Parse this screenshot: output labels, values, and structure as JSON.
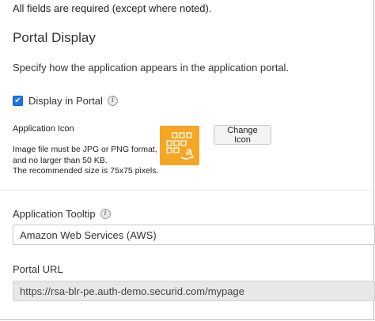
{
  "form": {
    "required_note": "All fields are required (except where noted)."
  },
  "portal_display": {
    "title": "Portal Display",
    "description": "Specify how the application appears in the application portal.",
    "display_in_portal": {
      "label": "Display in Portal",
      "checked": true
    },
    "application_icon": {
      "label": "Application Icon",
      "help_lines": [
        "Image file must be JPG or PNG format,",
        "and no larger than 50 KB.",
        "The recommended size is 75x75 pixels."
      ],
      "change_button_label": "Change Icon",
      "icon": "amazon-aws-logo-icon",
      "icon_bg_color": "#f5a623"
    },
    "application_tooltip": {
      "label": "Application Tooltip",
      "value": "Amazon Web Services (AWS)"
    },
    "portal_url": {
      "label": "Portal URL",
      "value": "https://rsa-blr-pe.auth-demo.securid.com/mypage"
    }
  },
  "colors": {
    "checkbox_accent": "#1a73e8",
    "readonly_bg": "#e8e8e8"
  }
}
